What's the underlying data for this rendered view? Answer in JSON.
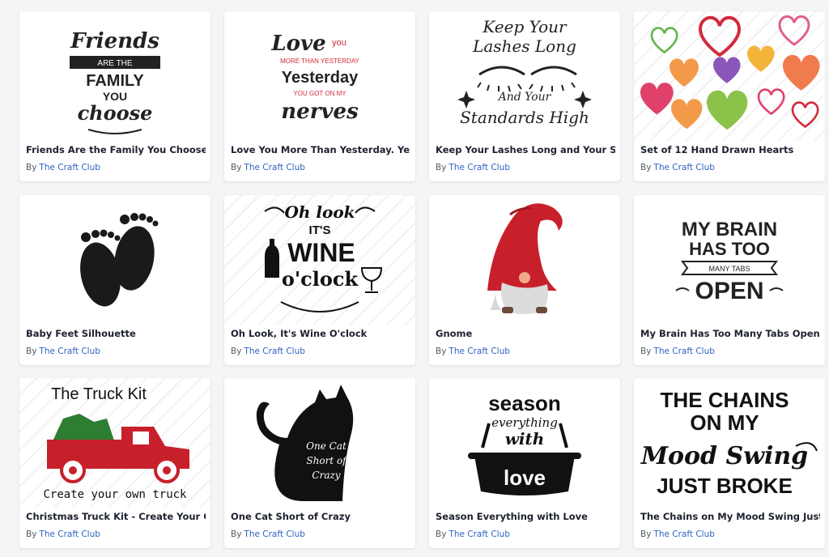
{
  "products": [
    {
      "title": "Friends Are the Family You Choose",
      "by": "By",
      "author": "The Craft Club",
      "art_lines": [
        "Friends",
        "ARE THE",
        "FAMILY",
        "YOU",
        "choose"
      ]
    },
    {
      "title": "Love You More Than Yesterday. Yes",
      "by": "By",
      "author": "The Craft Club",
      "art_lines": [
        "Love",
        "you",
        "MORE THAN YESTERDAY",
        "Yesterday",
        "YOU GOT ON MY",
        "nerves"
      ]
    },
    {
      "title": "Keep Your Lashes Long and Your Sta",
      "by": "By",
      "author": "The Craft Club",
      "art_lines": [
        "Keep Your",
        "Lashes Long",
        "And Your",
        "Standards High"
      ]
    },
    {
      "title": "Set of 12 Hand Drawn Hearts",
      "by": "By",
      "author": "The Craft Club",
      "art_lines": []
    },
    {
      "title": "Baby Feet Silhouette",
      "by": "By",
      "author": "The Craft Club",
      "art_lines": []
    },
    {
      "title": "Oh Look, It's Wine O'clock",
      "by": "By",
      "author": "The Craft Club",
      "art_lines": [
        "Oh look",
        "IT'S",
        "WINE",
        "o'clock"
      ]
    },
    {
      "title": "Gnome",
      "by": "By",
      "author": "The Craft Club",
      "art_lines": []
    },
    {
      "title": "My Brain Has Too Many Tabs Open",
      "by": "By",
      "author": "The Craft Club",
      "art_lines": [
        "MY BRAIN",
        "HAS TOO",
        "MANY TABS",
        "OPEN"
      ]
    },
    {
      "title": "Christmas Truck Kit - Create Your C",
      "by": "By",
      "author": "The Craft Club",
      "art_lines": [
        "The Truck Kit",
        "Create your own truck"
      ]
    },
    {
      "title": "One Cat Short of Crazy",
      "by": "By",
      "author": "The Craft Club",
      "art_lines": [
        "One Cat",
        "Short of",
        "Crazy"
      ]
    },
    {
      "title": "Season Everything with Love",
      "by": "By",
      "author": "The Craft Club",
      "art_lines": [
        "season",
        "everything",
        "with",
        "love"
      ]
    },
    {
      "title": "The Chains on My Mood Swing Just",
      "by": "By",
      "author": "The Craft Club",
      "art_lines": [
        "THE CHAINS",
        "ON MY",
        "Mood Swing",
        "JUST BROKE"
      ]
    }
  ],
  "colors": {
    "title": "#1d2130",
    "author_link": "#2f62c2",
    "accent_red": "#d22a3a"
  }
}
